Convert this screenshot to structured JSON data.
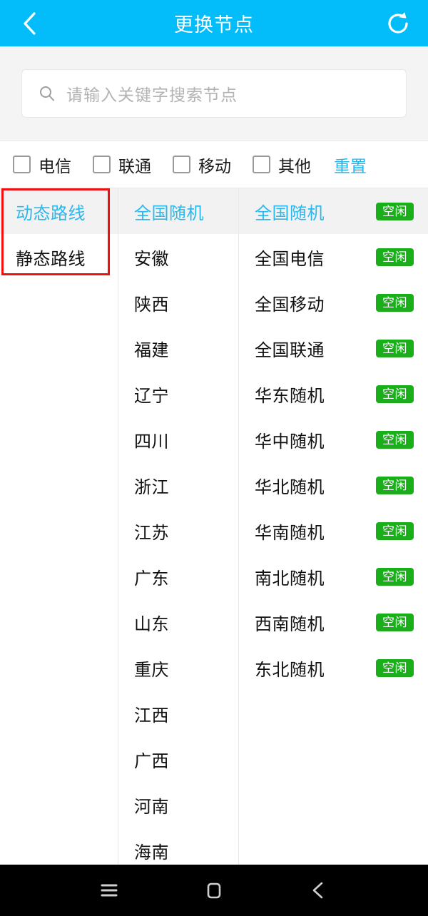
{
  "header": {
    "title": "更换节点",
    "back_icon": "chevron-left-icon",
    "refresh_icon": "refresh-icon",
    "background_color": "#03bdfb"
  },
  "search": {
    "placeholder": "请输入关键字搜索节点",
    "value": "",
    "icon": "search-icon"
  },
  "filters": {
    "items": [
      {
        "label": "电信",
        "checked": false
      },
      {
        "label": "联通",
        "checked": false
      },
      {
        "label": "移动",
        "checked": false
      },
      {
        "label": "其他",
        "checked": false
      }
    ],
    "reset_label": "重置",
    "reset_color": "#1fb6f0"
  },
  "columns": {
    "route_types": {
      "items": [
        {
          "label": "动态路线",
          "selected": true
        },
        {
          "label": "静态路线",
          "selected": false
        }
      ]
    },
    "regions": {
      "items": [
        {
          "label": "全国随机",
          "selected": true
        },
        {
          "label": "安徽",
          "selected": false
        },
        {
          "label": "陕西",
          "selected": false
        },
        {
          "label": "福建",
          "selected": false
        },
        {
          "label": "辽宁",
          "selected": false
        },
        {
          "label": "四川",
          "selected": false
        },
        {
          "label": "浙江",
          "selected": false
        },
        {
          "label": "江苏",
          "selected": false
        },
        {
          "label": "广东",
          "selected": false
        },
        {
          "label": "山东",
          "selected": false
        },
        {
          "label": "重庆",
          "selected": false
        },
        {
          "label": "江西",
          "selected": false
        },
        {
          "label": "广西",
          "selected": false
        },
        {
          "label": "河南",
          "selected": false
        },
        {
          "label": "海南",
          "selected": false
        }
      ]
    },
    "nodes": {
      "status_color": "#1aae1a",
      "items": [
        {
          "label": "全国随机",
          "status": "空闲",
          "selected": true
        },
        {
          "label": "全国电信",
          "status": "空闲",
          "selected": false
        },
        {
          "label": "全国移动",
          "status": "空闲",
          "selected": false
        },
        {
          "label": "全国联通",
          "status": "空闲",
          "selected": false
        },
        {
          "label": "华东随机",
          "status": "空闲",
          "selected": false
        },
        {
          "label": "华中随机",
          "status": "空闲",
          "selected": false
        },
        {
          "label": "华北随机",
          "status": "空闲",
          "selected": false
        },
        {
          "label": "华南随机",
          "status": "空闲",
          "selected": false
        },
        {
          "label": "南北随机",
          "status": "空闲",
          "selected": false
        },
        {
          "label": "西南随机",
          "status": "空闲",
          "selected": false
        },
        {
          "label": "东北随机",
          "status": "空闲",
          "selected": false
        }
      ]
    }
  },
  "annotation": {
    "color": "#ee1111"
  },
  "navbar": {
    "menu_icon": "menu-icon",
    "home_icon": "home-square-icon",
    "back_icon": "chevron-left-icon"
  }
}
